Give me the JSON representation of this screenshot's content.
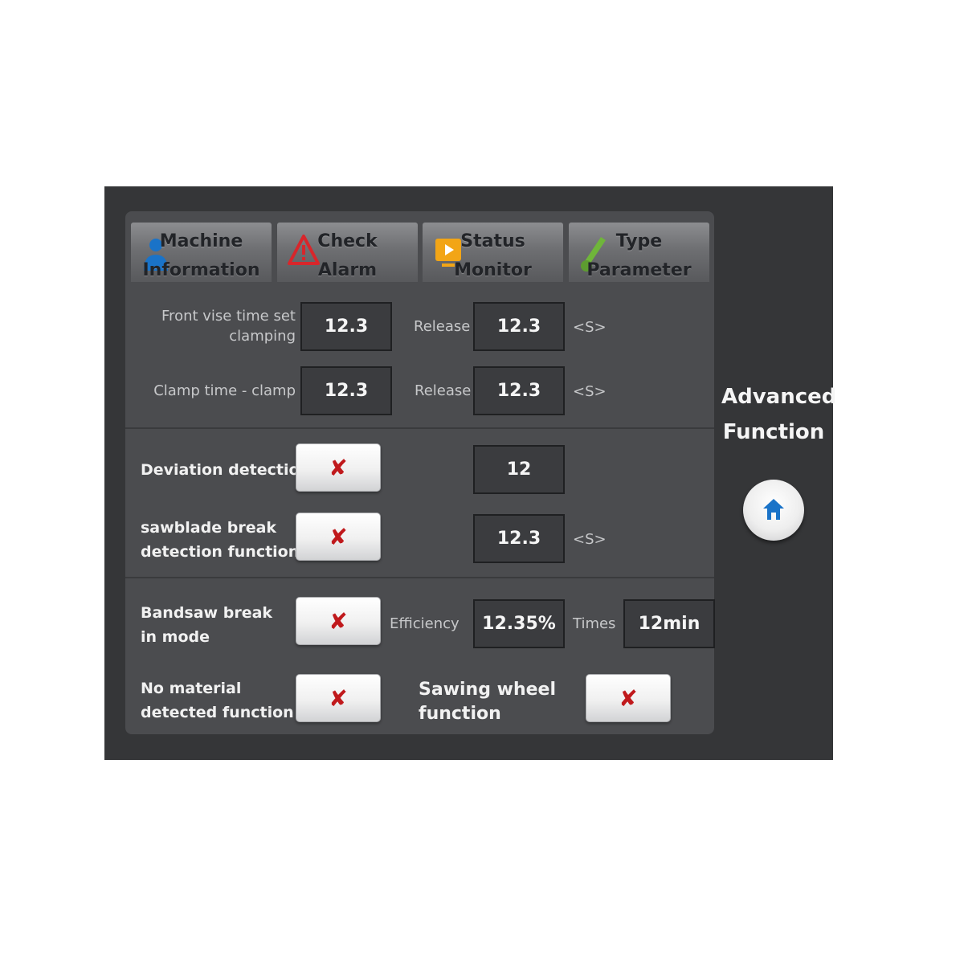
{
  "tabs": [
    {
      "line1": "Machine",
      "line2": "Information",
      "icon": "user-icon"
    },
    {
      "line1": "Check",
      "line2": "Alarm",
      "icon": "warning-icon"
    },
    {
      "line1": "Status",
      "line2": "Monitor",
      "icon": "monitor-icon"
    },
    {
      "line1": "Type",
      "line2": "Parameter",
      "icon": "edit-icon"
    }
  ],
  "front_vise": {
    "label_line1": "Front vise time set",
    "label_line2": "clamping",
    "value": "12.3",
    "release_label": "Release",
    "release_value": "12.3",
    "unit": "<S>"
  },
  "clamp_time": {
    "label": "Clamp time - clamp",
    "value": "12.3",
    "release_label": "Release",
    "release_value": "12.3",
    "unit": "<S>"
  },
  "deviation": {
    "label": "Deviation detection",
    "value": "12"
  },
  "sawblade": {
    "label_line1": "sawblade break",
    "label_line2": "detection function",
    "value": "12.3",
    "unit": "<S>"
  },
  "bandsaw": {
    "label_line1": "Bandsaw break",
    "label_line2": "in mode",
    "efficiency_label": "Efficiency",
    "efficiency_value": "12.35%",
    "times_label": "Times",
    "times_value": "12min"
  },
  "no_material": {
    "label_line1": "No material",
    "label_line2": "detected function"
  },
  "sawing_wheel": {
    "label_line1": "Sawing wheel",
    "label_line2": "function"
  },
  "toggle_symbol": "✘",
  "advanced": {
    "line1": "Advanced",
    "line2": "Function",
    "icon": "home-icon"
  },
  "colors": {
    "accent_blue": "#1a73c8",
    "off_red": "#c0191c",
    "alarm_red": "#d8262b",
    "monitor_orange": "#f2a516",
    "param_green": "#6fb53a"
  }
}
